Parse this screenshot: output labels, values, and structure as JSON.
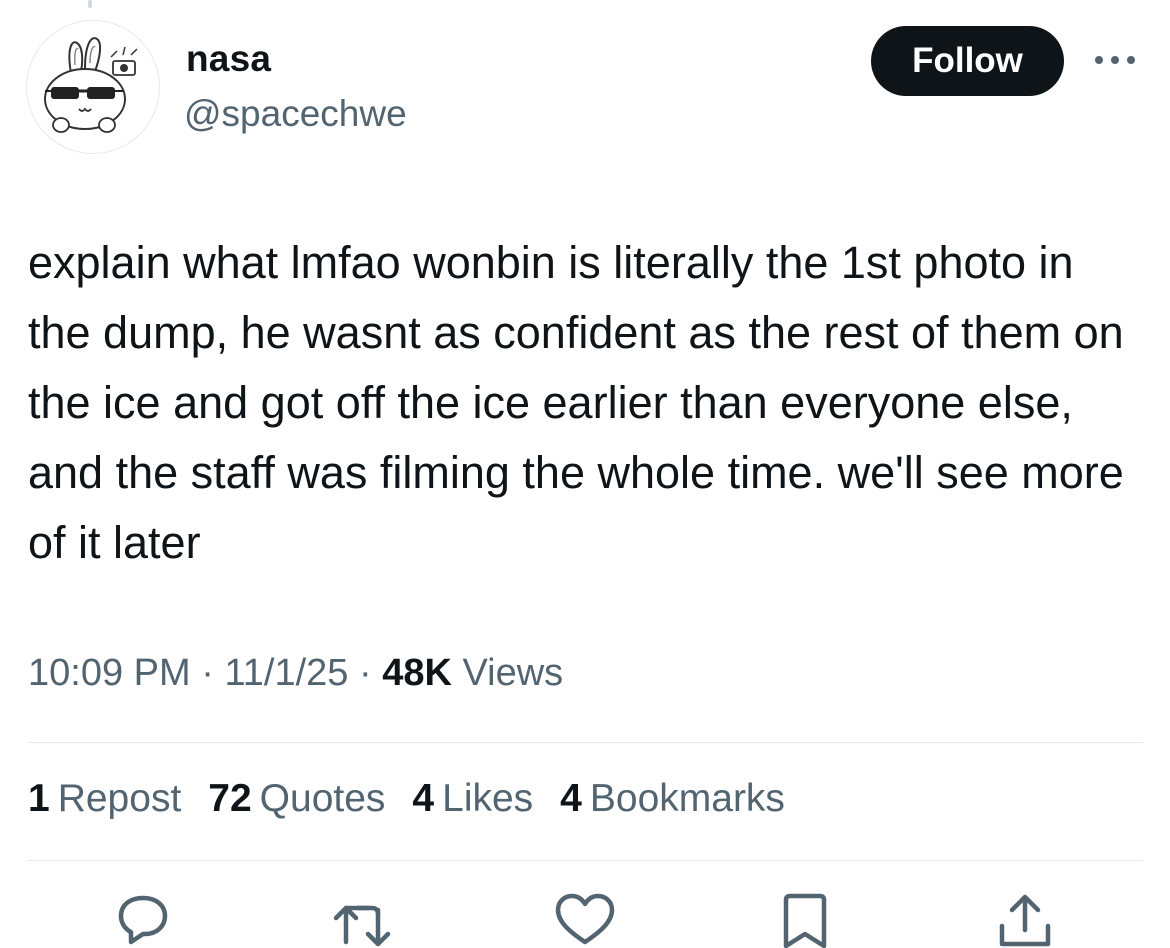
{
  "author": {
    "display_name": "nasa",
    "handle": "@spacechwe",
    "avatar_icon": "cartoon-bunny-sunglasses-avatar"
  },
  "follow_button": {
    "label": "Follow"
  },
  "more_icon": "more-horizontal-icon",
  "tweet": {
    "text": "explain what lmfao wonbin is literally the 1st photo in the dump, he wasnt as confident as the rest of them on the ice and got off the ice earlier than everyone else, and the staff was filming the whole time. we'll see more of it later"
  },
  "meta": {
    "time": "10:09 PM",
    "separator": "·",
    "date": "11/1/25",
    "views_count": "48K",
    "views_label": "Views"
  },
  "stats": [
    {
      "count": "1",
      "label": "Repost"
    },
    {
      "count": "72",
      "label": "Quotes"
    },
    {
      "count": "4",
      "label": "Likes"
    },
    {
      "count": "4",
      "label": "Bookmarks"
    }
  ],
  "actions": [
    {
      "icon": "reply-icon"
    },
    {
      "icon": "repost-icon"
    },
    {
      "icon": "like-icon"
    },
    {
      "icon": "bookmark-icon"
    },
    {
      "icon": "share-icon"
    }
  ],
  "colors": {
    "text_primary": "#0f1419",
    "text_secondary": "#536471",
    "divider": "#e4e8eb",
    "button_bg": "#0f1419",
    "button_text": "#ffffff"
  }
}
